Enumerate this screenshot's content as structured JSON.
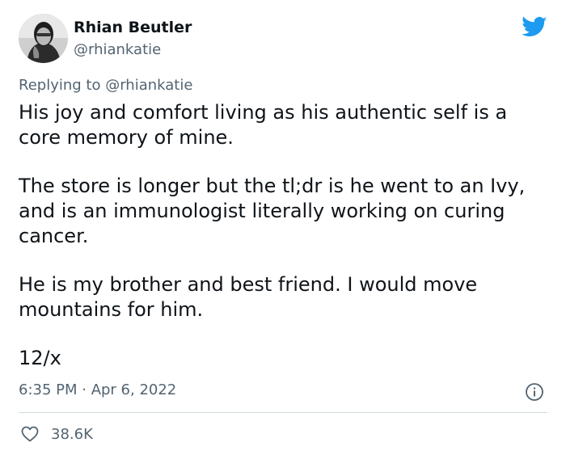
{
  "author": {
    "display_name": "Rhian Beutler",
    "handle": "@rhiankatie"
  },
  "reply": {
    "prefix": "Replying to ",
    "mention": "@rhiankatie"
  },
  "body": {
    "paragraphs": [
      "His joy and comfort living as his authentic self is a core memory of mine.",
      "The store is longer but the tl;dr is he went to an Ivy, and is an immunologist literally working on curing cancer.",
      "He is my brother and best friend. I would move mountains for him.",
      "12/x"
    ]
  },
  "meta": {
    "timestamp": "6:35 PM · Apr 6, 2022"
  },
  "engagement": {
    "likes": "38.6K"
  },
  "icons": {
    "brand": "twitter-bird-icon",
    "info": "info-icon",
    "like": "heart-icon"
  },
  "colors": {
    "brand": "#1d9bf0",
    "text": "#0f1419",
    "secondary": "#536471",
    "divider": "#cfd9de"
  }
}
